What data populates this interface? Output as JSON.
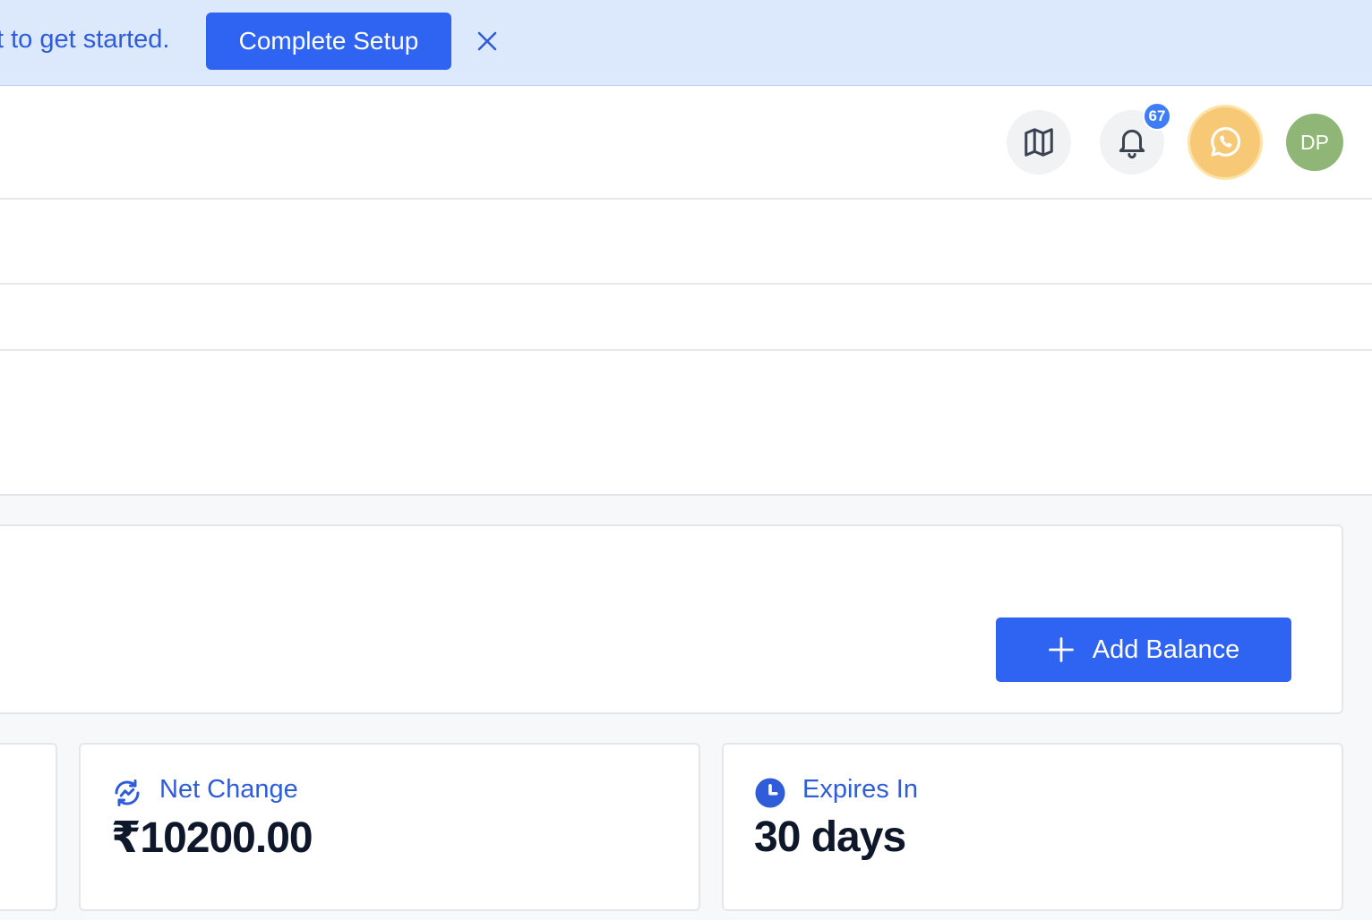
{
  "banner": {
    "text": "t to get started.",
    "button_label": "Complete Setup"
  },
  "header": {
    "notification_count": "67",
    "avatar_initials": "DP"
  },
  "balance": {
    "add_button_label": "Add Balance"
  },
  "stats": [
    {
      "label": "Net Change",
      "value": "₹10200.00",
      "icon": "trend-refresh-icon"
    },
    {
      "label": "Expires In",
      "value": "30 days",
      "icon": "clock-icon"
    }
  ],
  "colors": {
    "primary": "#2f63f1",
    "banner_bg": "#dce9fc",
    "link_text": "#2f5cd8",
    "whatsapp_bg": "#f7c977",
    "avatar_bg": "#8fb676",
    "badge_bg": "#3f7df6"
  }
}
